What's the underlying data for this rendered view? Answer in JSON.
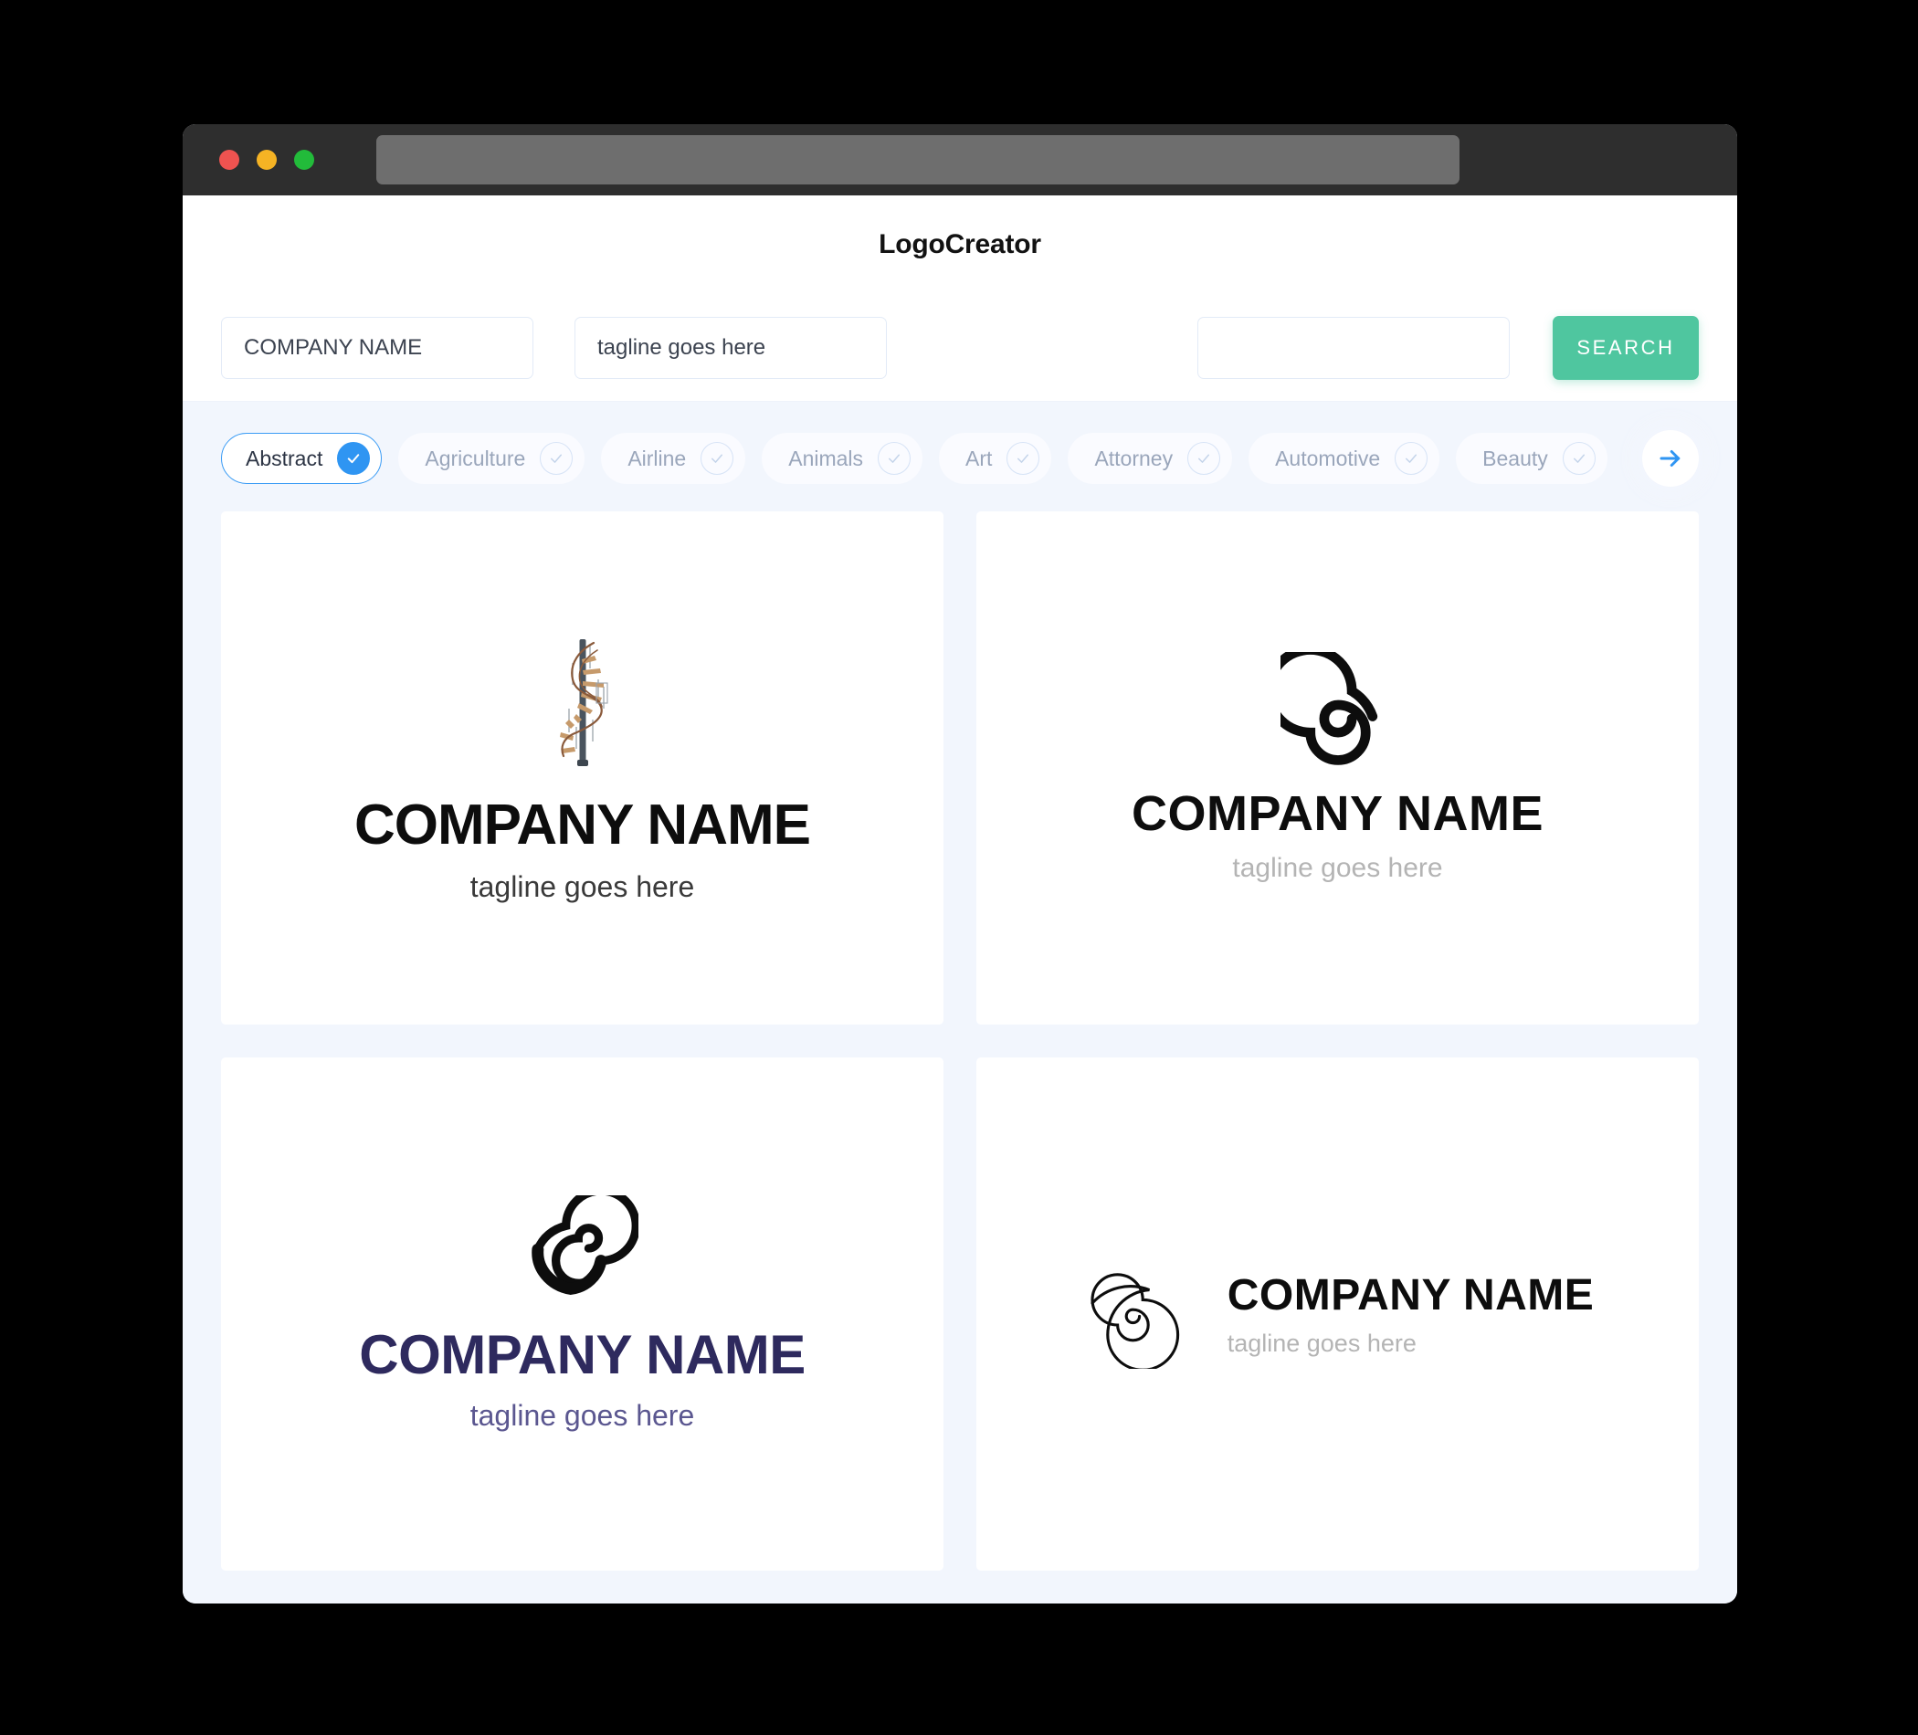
{
  "window": {
    "traffic_lights": [
      {
        "name": "close",
        "color": "#ef5350"
      },
      {
        "name": "minimize",
        "color": "#f5b324"
      },
      {
        "name": "maximize",
        "color": "#22bb3a"
      }
    ],
    "url_value": ""
  },
  "header": {
    "title": "LogoCreator"
  },
  "search": {
    "company_value": "COMPANY NAME",
    "company_placeholder": "COMPANY NAME",
    "tagline_value": "tagline goes here",
    "tagline_placeholder": "tagline goes here",
    "extra_value": "",
    "extra_placeholder": "",
    "button_label": "SEARCH",
    "button_color": "#4fc69f"
  },
  "categories": {
    "accent_color": "#2f95f2",
    "next_icon": "arrow-right-icon",
    "items": [
      {
        "label": "Abstract",
        "selected": true
      },
      {
        "label": "Agriculture",
        "selected": false
      },
      {
        "label": "Airline",
        "selected": false
      },
      {
        "label": "Animals",
        "selected": false
      },
      {
        "label": "Art",
        "selected": false
      },
      {
        "label": "Attorney",
        "selected": false
      },
      {
        "label": "Automotive",
        "selected": false
      },
      {
        "label": "Beauty",
        "selected": false
      }
    ]
  },
  "logos": [
    {
      "icon": "spiral-staircase-icon",
      "layout": "stacked",
      "name": "COMPANY NAME",
      "tagline": "tagline goes here",
      "name_color": "#0d0d0d",
      "tagline_color": "#3a3a3a"
    },
    {
      "icon": "spiral-icon",
      "layout": "stacked",
      "name": "COMPANY NAME",
      "tagline": "tagline goes here",
      "name_color": "#0d0d0d",
      "tagline_color": "#b4b4b4"
    },
    {
      "icon": "tapered-spiral-icon",
      "layout": "stacked",
      "name": "COMPANY NAME",
      "tagline": "tagline goes here",
      "name_color": "#2e2a5e",
      "tagline_color": "#5b5790"
    },
    {
      "icon": "thin-spiral-icon",
      "layout": "horizontal",
      "name": "COMPANY NAME",
      "tagline": "tagline goes here",
      "name_color": "#0d0d0d",
      "tagline_color": "#b4b4b4"
    }
  ]
}
